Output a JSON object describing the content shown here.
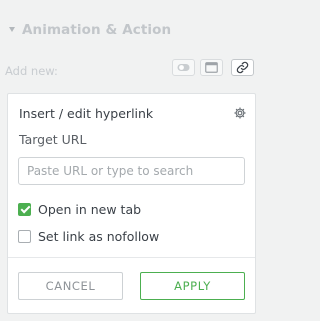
{
  "section": {
    "title": "Animation & Action",
    "add_new_label": "Add new:"
  },
  "toolbar": {
    "buttons": [
      {
        "icon": "toggle-icon"
      },
      {
        "icon": "window-icon"
      },
      {
        "icon": "link-icon",
        "active": true
      }
    ]
  },
  "popup": {
    "title": "Insert / edit hyperlink",
    "target_label": "Target URL",
    "url_input": {
      "value": "",
      "placeholder": "Paste URL or type to search"
    },
    "options": [
      {
        "label": "Open in new tab",
        "checked": true
      },
      {
        "label": "Set link as nofollow",
        "checked": false
      }
    ],
    "cancel_label": "Cancel",
    "apply_label": "Apply"
  },
  "colors": {
    "accent": "#4caf50",
    "background": "#f1f2f2",
    "text": "#3b4148"
  }
}
